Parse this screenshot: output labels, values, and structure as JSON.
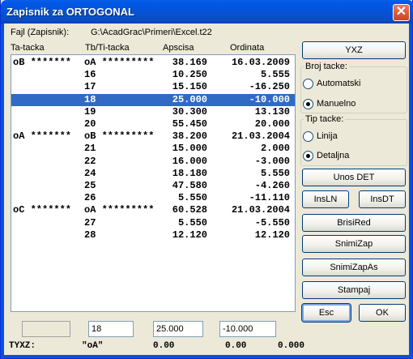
{
  "window": {
    "title": "Zapisnik za ORTOGONAL",
    "close_symbol": "✕"
  },
  "file": {
    "label": "Fajl (Zapisnik):",
    "path": "G:\\AcadGrac\\Primeri\\Excel.t22"
  },
  "columns": [
    "Ta-tacka",
    "Tb/Ti-tacka",
    "Apscisa",
    "Ordinata"
  ],
  "rows": [
    [
      "oB *******",
      "oA *********",
      "38.169",
      "16.03.2009"
    ],
    [
      "",
      "16",
      "10.250",
      "5.555"
    ],
    [
      "",
      "17",
      "15.150",
      "-16.250"
    ],
    [
      "",
      "18",
      "25.000",
      "-10.000"
    ],
    [
      "",
      "19",
      "30.300",
      "13.130"
    ],
    [
      "",
      "20",
      "55.450",
      "20.000"
    ],
    [
      "oA *******",
      "oB *********",
      "38.200",
      "21.03.2004"
    ],
    [
      "",
      "21",
      "15.000",
      "2.000"
    ],
    [
      "",
      "22",
      "16.000",
      "-3.000"
    ],
    [
      "",
      "24",
      "18.180",
      "5.550"
    ],
    [
      "",
      "25",
      "47.580",
      "-4.260"
    ],
    [
      "",
      "26",
      "5.550",
      "-11.110"
    ],
    [
      "oC *******",
      "oA *********",
      "60.528",
      "21.03.2004"
    ],
    [
      "",
      "27",
      "5.550",
      "-5.550"
    ],
    [
      "",
      "28",
      "12.120",
      "12.120"
    ]
  ],
  "selected_row_index": 3,
  "buttons": {
    "yxz": "YXZ",
    "unos_det": "Unos DET",
    "insln": "InsLN",
    "insdt": "InsDT",
    "brisired": "BrisiRed",
    "snimizap": "SnimiZap",
    "snimizapas": "SnimiZapAs",
    "stampaj": "Stampaj",
    "esc": "Esc",
    "ok": "OK"
  },
  "broj_tacke": {
    "label": "Broj tacke:",
    "options": [
      "Automatski",
      "Manuelno"
    ],
    "selected": "Manuelno"
  },
  "tip_tacke": {
    "label": "Tip tacke:",
    "options": [
      "Linija",
      "Detaljna"
    ],
    "selected": "Detaljna"
  },
  "edit": {
    "field_empty": "",
    "point": "18",
    "apscisa": "25.000",
    "ordinata": "-10.000"
  },
  "status": {
    "label": "TYXZ:",
    "point": "\"oA\"",
    "v1": "0.00",
    "v2": "0.00",
    "v3": "0.000"
  }
}
